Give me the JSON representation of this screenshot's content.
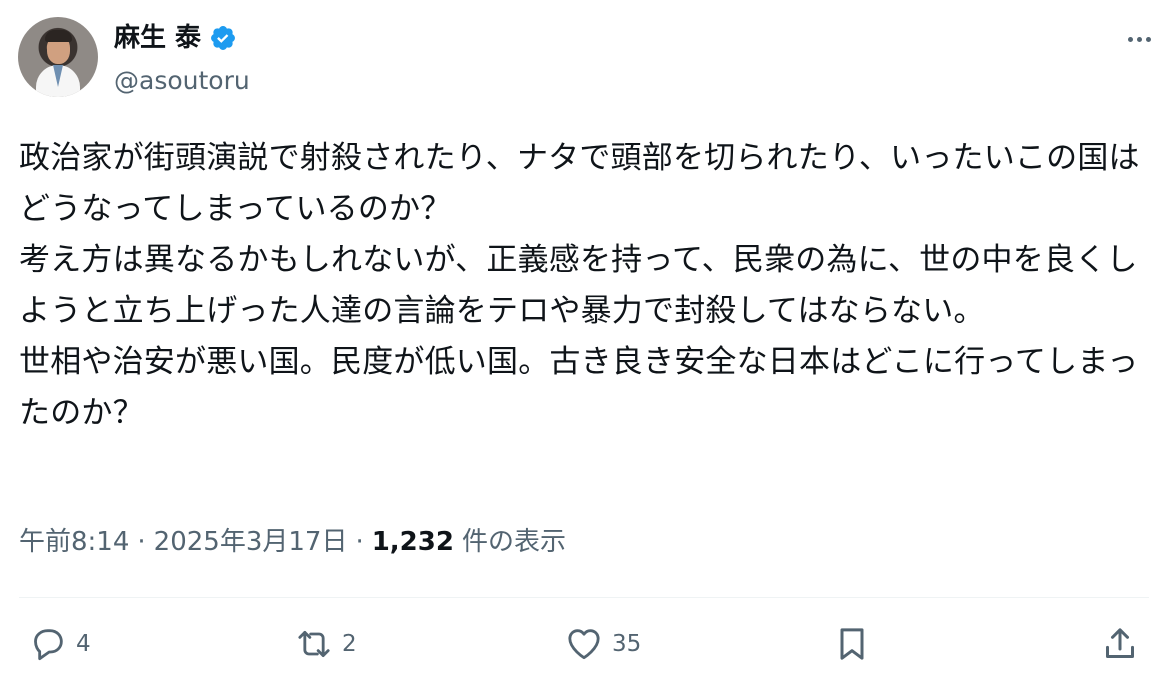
{
  "user": {
    "display_name": "麻生 泰",
    "handle": "@asoutoru",
    "verified": true,
    "verified_color": "#1d9bf0"
  },
  "tweet": {
    "text": "政治家が街頭演説で射殺されたり、ナタで頭部を切られたり、いったいこの国はどうなってしまっているのか？\n考え方は異なるかもしれないが、正義感を持って、民衆の為に、世の中を良くしようと立ち上げった人達の言論をテロや暴力で封殺してはならない。\n世相や治安が悪い国。民度が低い国。古き良き安全な日本はどこに行ってしまったのか？"
  },
  "meta": {
    "time": "午前8:14",
    "separator": "·",
    "date": "2025年3月17日",
    "views_count": "1,232",
    "views_label": "件の表示"
  },
  "actions": {
    "reply_count": "4",
    "retweet_count": "2",
    "like_count": "35"
  },
  "colors": {
    "text": "#0f1419",
    "secondary": "#536471",
    "divider": "#eff3f4"
  }
}
